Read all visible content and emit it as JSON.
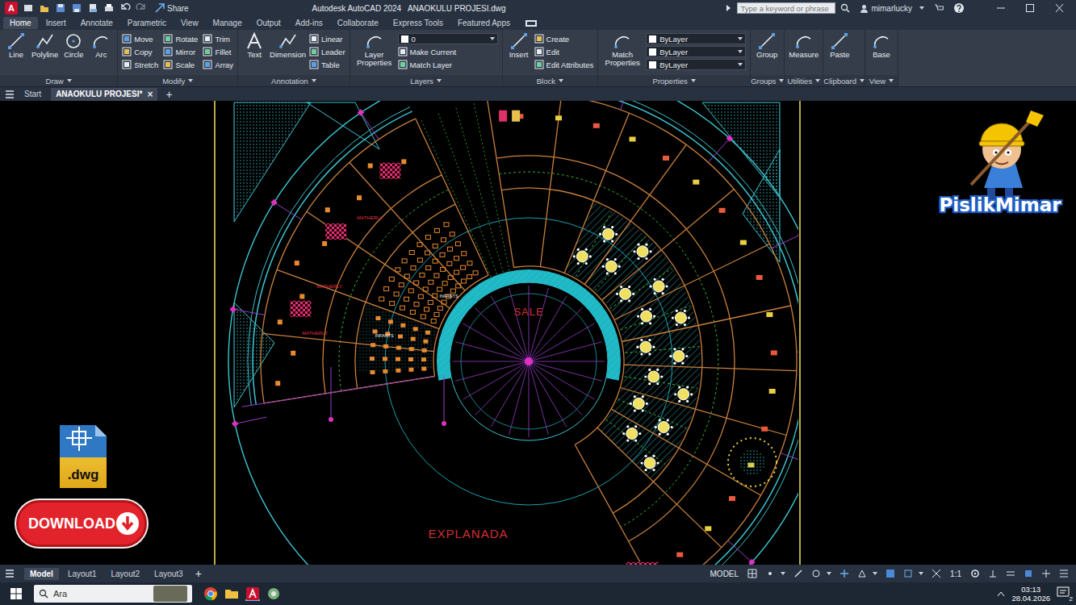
{
  "window": {
    "app_badge": "A",
    "share": "Share",
    "title": "Autodesk AutoCAD 2024   ANAOKULU PROJESI.dwg",
    "search_placeholder": "Type a keyword or phrase",
    "user": "mimarlucky"
  },
  "ribbon_tabs": [
    {
      "label": "Home",
      "selected": true
    },
    {
      "label": "Insert",
      "selected": false
    },
    {
      "label": "Annotate",
      "selected": false
    },
    {
      "label": "Parametric",
      "selected": false
    },
    {
      "label": "View",
      "selected": false
    },
    {
      "label": "Manage",
      "selected": false
    },
    {
      "label": "Output",
      "selected": false
    },
    {
      "label": "Add-ins",
      "selected": false
    },
    {
      "label": "Collaborate",
      "selected": false
    },
    {
      "label": "Express Tools",
      "selected": false
    },
    {
      "label": "Featured Apps",
      "selected": false
    }
  ],
  "ribbon_groups": [
    {
      "title": "Draw",
      "tools": [
        {
          "label": "Line",
          "kind": "large"
        },
        {
          "label": "Polyline",
          "kind": "large"
        },
        {
          "label": "Circle",
          "kind": "large"
        },
        {
          "label": "Arc",
          "kind": "large"
        }
      ]
    },
    {
      "title": "Modify",
      "tools": [
        {
          "label": "Move",
          "kind": "small"
        },
        {
          "label": "Copy",
          "kind": "small"
        },
        {
          "label": "Stretch",
          "kind": "small"
        },
        {
          "label": "Rotate",
          "kind": "small"
        },
        {
          "label": "Mirror",
          "kind": "small"
        },
        {
          "label": "Scale",
          "kind": "small"
        },
        {
          "label": "Trim",
          "kind": "small"
        },
        {
          "label": "Fillet",
          "kind": "small"
        },
        {
          "label": "Array",
          "kind": "small"
        }
      ]
    },
    {
      "title": "Annotation",
      "tools": [
        {
          "label": "Text",
          "kind": "large"
        },
        {
          "label": "Dimension",
          "kind": "large"
        },
        {
          "label": "Linear",
          "kind": "small"
        },
        {
          "label": "Leader",
          "kind": "small"
        },
        {
          "label": "Table",
          "kind": "small"
        }
      ]
    },
    {
      "title": "Layers",
      "tools": [
        {
          "label": "Layer Properties",
          "kind": "large"
        },
        {
          "label": "0",
          "kind": "combo"
        },
        {
          "label": "Make Current",
          "kind": "small"
        },
        {
          "label": "Match Layer",
          "kind": "small"
        }
      ]
    },
    {
      "title": "Block",
      "tools": [
        {
          "label": "Insert",
          "kind": "large"
        },
        {
          "label": "Create",
          "kind": "small"
        },
        {
          "label": "Edit",
          "kind": "small"
        },
        {
          "label": "Edit Attributes",
          "kind": "small"
        }
      ]
    },
    {
      "title": "Properties",
      "tools": [
        {
          "label": "Match Properties",
          "kind": "large"
        },
        {
          "label": "ByLayer",
          "kind": "combo"
        },
        {
          "label": "ByLayer",
          "kind": "combo"
        },
        {
          "label": "ByLayer",
          "kind": "combo"
        }
      ]
    },
    {
      "title": "Groups",
      "tools": [
        {
          "label": "Group",
          "kind": "large"
        }
      ]
    },
    {
      "title": "Utilities",
      "tools": [
        {
          "label": "Measure",
          "kind": "large"
        }
      ]
    },
    {
      "title": "Clipboard",
      "tools": [
        {
          "label": "Paste",
          "kind": "large"
        }
      ]
    },
    {
      "title": "View",
      "tools": [
        {
          "label": "Base",
          "kind": "large"
        }
      ]
    }
  ],
  "doc_tabs": [
    {
      "label": "Start",
      "selected": false
    },
    {
      "label": "ANAOKULU PROJESI*",
      "selected": true
    }
  ],
  "doc_close": "×",
  "doc_add": "+",
  "drawing": {
    "labels": [
      "SALE",
      "EXPLANADA",
      "MATHERLY",
      "MATHERLY",
      "MATHERLY",
      "INFANTS",
      "INFANTS"
    ]
  },
  "overlays": {
    "brand": "PislikMimar",
    "file_ext": ".dwg",
    "download": "DOWNLOAD"
  },
  "layout_tabs": [
    {
      "label": "Model",
      "selected": true
    },
    {
      "label": "Layout1",
      "selected": false
    },
    {
      "label": "Layout2",
      "selected": false
    },
    {
      "label": "Layout3",
      "selected": false
    }
  ],
  "layout_add": "+",
  "status": {
    "space": "MODEL",
    "scale": "1:1"
  },
  "taskbar": {
    "search": "Ara",
    "time": "03:13",
    "date": "28.04.2026",
    "badge": "2"
  }
}
